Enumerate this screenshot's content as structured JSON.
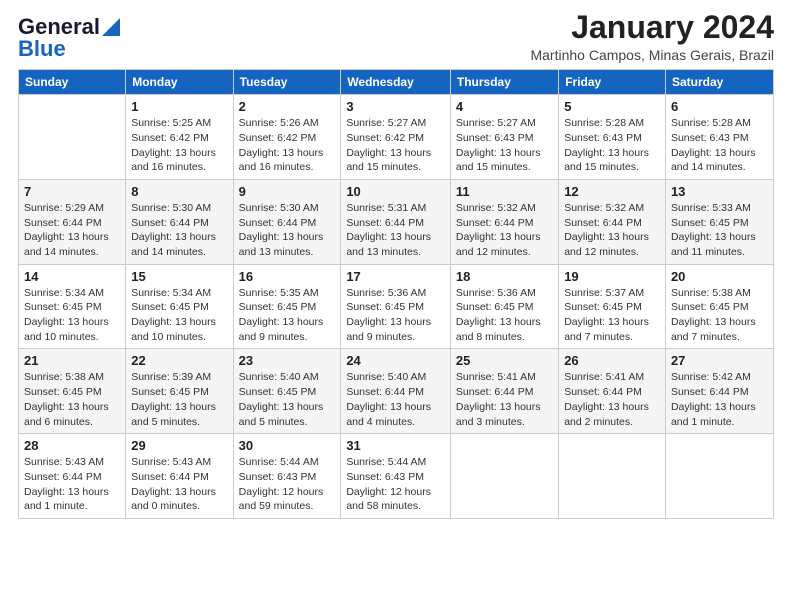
{
  "logo": {
    "line1": "General",
    "line2": "Blue"
  },
  "title": "January 2024",
  "location": "Martinho Campos, Minas Gerais, Brazil",
  "days_header": [
    "Sunday",
    "Monday",
    "Tuesday",
    "Wednesday",
    "Thursday",
    "Friday",
    "Saturday"
  ],
  "weeks": [
    [
      {
        "day": "",
        "info": ""
      },
      {
        "day": "1",
        "info": "Sunrise: 5:25 AM\nSunset: 6:42 PM\nDaylight: 13 hours\nand 16 minutes."
      },
      {
        "day": "2",
        "info": "Sunrise: 5:26 AM\nSunset: 6:42 PM\nDaylight: 13 hours\nand 16 minutes."
      },
      {
        "day": "3",
        "info": "Sunrise: 5:27 AM\nSunset: 6:42 PM\nDaylight: 13 hours\nand 15 minutes."
      },
      {
        "day": "4",
        "info": "Sunrise: 5:27 AM\nSunset: 6:43 PM\nDaylight: 13 hours\nand 15 minutes."
      },
      {
        "day": "5",
        "info": "Sunrise: 5:28 AM\nSunset: 6:43 PM\nDaylight: 13 hours\nand 15 minutes."
      },
      {
        "day": "6",
        "info": "Sunrise: 5:28 AM\nSunset: 6:43 PM\nDaylight: 13 hours\nand 14 minutes."
      }
    ],
    [
      {
        "day": "7",
        "info": "Sunrise: 5:29 AM\nSunset: 6:44 PM\nDaylight: 13 hours\nand 14 minutes."
      },
      {
        "day": "8",
        "info": "Sunrise: 5:30 AM\nSunset: 6:44 PM\nDaylight: 13 hours\nand 14 minutes."
      },
      {
        "day": "9",
        "info": "Sunrise: 5:30 AM\nSunset: 6:44 PM\nDaylight: 13 hours\nand 13 minutes."
      },
      {
        "day": "10",
        "info": "Sunrise: 5:31 AM\nSunset: 6:44 PM\nDaylight: 13 hours\nand 13 minutes."
      },
      {
        "day": "11",
        "info": "Sunrise: 5:32 AM\nSunset: 6:44 PM\nDaylight: 13 hours\nand 12 minutes."
      },
      {
        "day": "12",
        "info": "Sunrise: 5:32 AM\nSunset: 6:44 PM\nDaylight: 13 hours\nand 12 minutes."
      },
      {
        "day": "13",
        "info": "Sunrise: 5:33 AM\nSunset: 6:45 PM\nDaylight: 13 hours\nand 11 minutes."
      }
    ],
    [
      {
        "day": "14",
        "info": "Sunrise: 5:34 AM\nSunset: 6:45 PM\nDaylight: 13 hours\nand 10 minutes."
      },
      {
        "day": "15",
        "info": "Sunrise: 5:34 AM\nSunset: 6:45 PM\nDaylight: 13 hours\nand 10 minutes."
      },
      {
        "day": "16",
        "info": "Sunrise: 5:35 AM\nSunset: 6:45 PM\nDaylight: 13 hours\nand 9 minutes."
      },
      {
        "day": "17",
        "info": "Sunrise: 5:36 AM\nSunset: 6:45 PM\nDaylight: 13 hours\nand 9 minutes."
      },
      {
        "day": "18",
        "info": "Sunrise: 5:36 AM\nSunset: 6:45 PM\nDaylight: 13 hours\nand 8 minutes."
      },
      {
        "day": "19",
        "info": "Sunrise: 5:37 AM\nSunset: 6:45 PM\nDaylight: 13 hours\nand 7 minutes."
      },
      {
        "day": "20",
        "info": "Sunrise: 5:38 AM\nSunset: 6:45 PM\nDaylight: 13 hours\nand 7 minutes."
      }
    ],
    [
      {
        "day": "21",
        "info": "Sunrise: 5:38 AM\nSunset: 6:45 PM\nDaylight: 13 hours\nand 6 minutes."
      },
      {
        "day": "22",
        "info": "Sunrise: 5:39 AM\nSunset: 6:45 PM\nDaylight: 13 hours\nand 5 minutes."
      },
      {
        "day": "23",
        "info": "Sunrise: 5:40 AM\nSunset: 6:45 PM\nDaylight: 13 hours\nand 5 minutes."
      },
      {
        "day": "24",
        "info": "Sunrise: 5:40 AM\nSunset: 6:44 PM\nDaylight: 13 hours\nand 4 minutes."
      },
      {
        "day": "25",
        "info": "Sunrise: 5:41 AM\nSunset: 6:44 PM\nDaylight: 13 hours\nand 3 minutes."
      },
      {
        "day": "26",
        "info": "Sunrise: 5:41 AM\nSunset: 6:44 PM\nDaylight: 13 hours\nand 2 minutes."
      },
      {
        "day": "27",
        "info": "Sunrise: 5:42 AM\nSunset: 6:44 PM\nDaylight: 13 hours\nand 1 minute."
      }
    ],
    [
      {
        "day": "28",
        "info": "Sunrise: 5:43 AM\nSunset: 6:44 PM\nDaylight: 13 hours\nand 1 minute."
      },
      {
        "day": "29",
        "info": "Sunrise: 5:43 AM\nSunset: 6:44 PM\nDaylight: 13 hours\nand 0 minutes."
      },
      {
        "day": "30",
        "info": "Sunrise: 5:44 AM\nSunset: 6:43 PM\nDaylight: 12 hours\nand 59 minutes."
      },
      {
        "day": "31",
        "info": "Sunrise: 5:44 AM\nSunset: 6:43 PM\nDaylight: 12 hours\nand 58 minutes."
      },
      {
        "day": "",
        "info": ""
      },
      {
        "day": "",
        "info": ""
      },
      {
        "day": "",
        "info": ""
      }
    ]
  ]
}
